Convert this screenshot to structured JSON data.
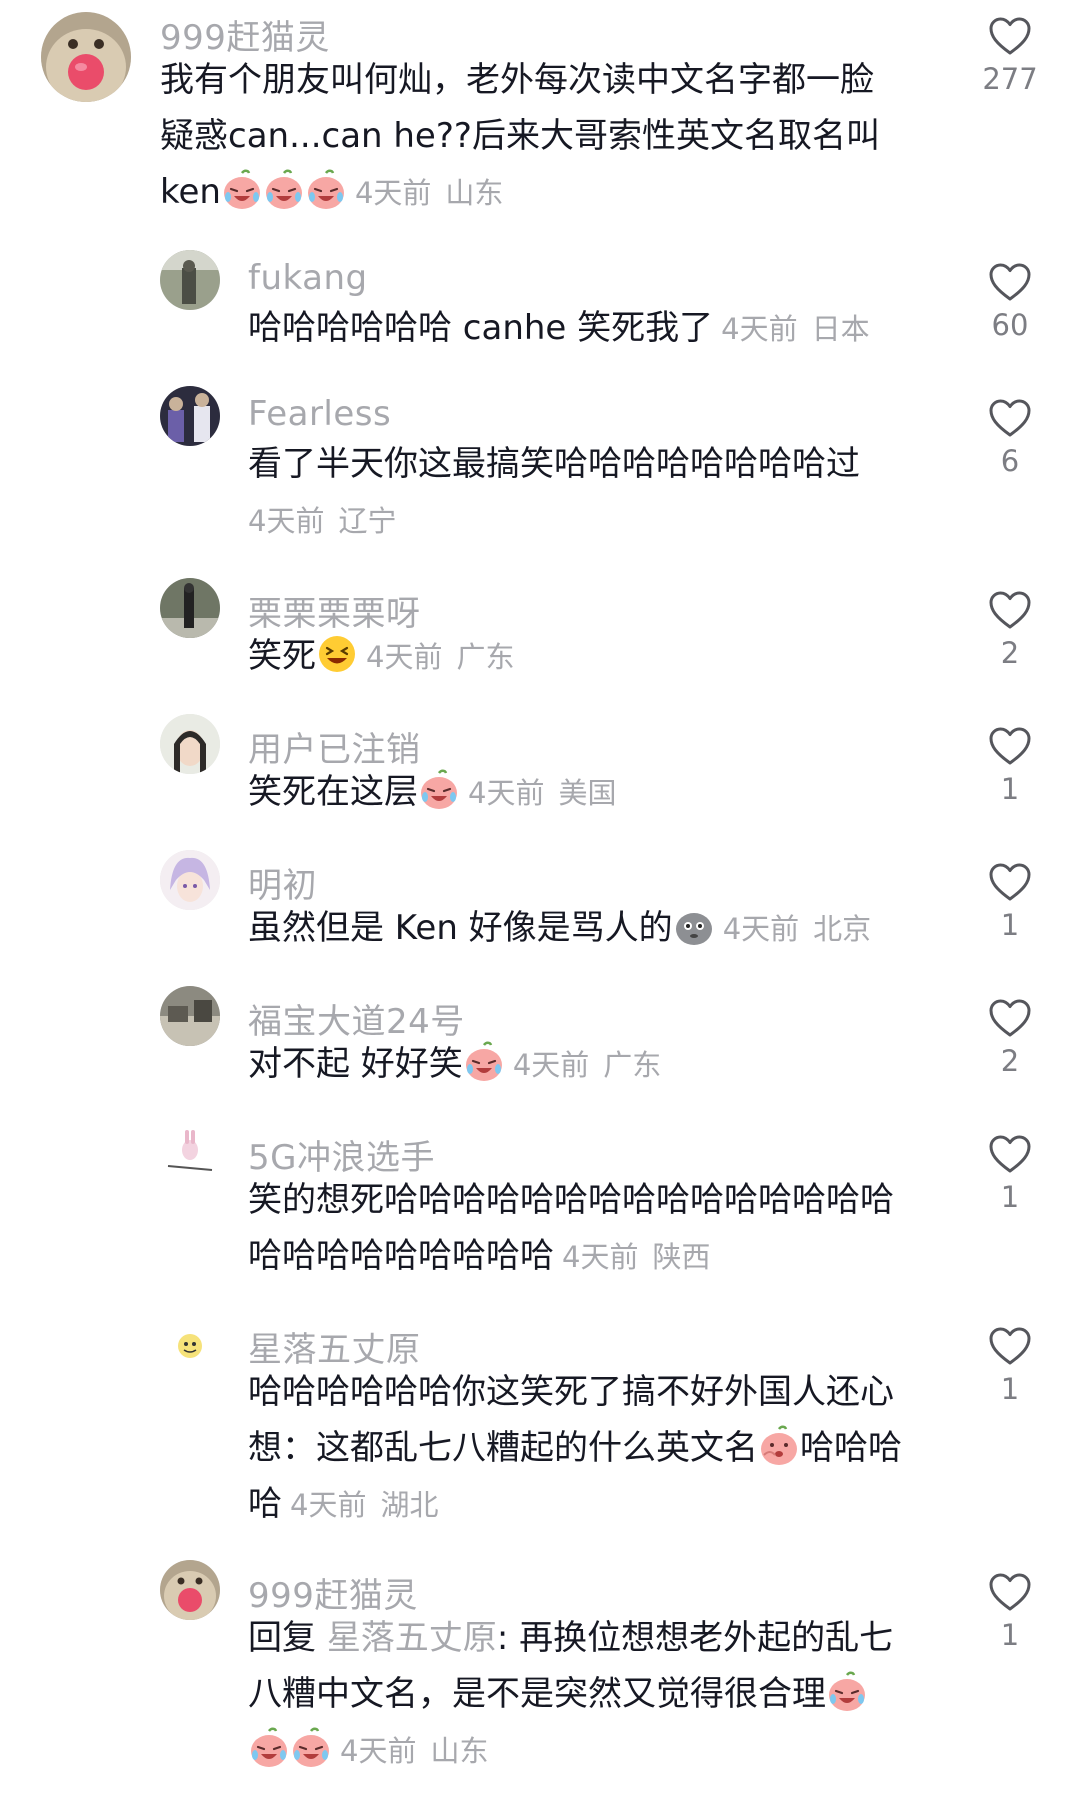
{
  "comments": [
    {
      "username": "999赶猫灵",
      "lines": [
        "我有个朋友叫何灿，老外每次读中文名字都一脸",
        "疑惑can...can he??后来大哥索性英文名取名叫",
        "ken"
      ],
      "time": "4天前",
      "location": "山东",
      "likes": "277"
    },
    {
      "username": "fukang",
      "lines": [
        "哈哈哈哈哈哈 canhe 笑死我了"
      ],
      "time": "4天前",
      "location": "日本",
      "likes": "60"
    },
    {
      "username": "Fearless",
      "lines": [
        "看了半天你这最搞笑哈哈哈哈哈哈哈哈过"
      ],
      "time": "4天前",
      "location": "辽宁",
      "likes": "6"
    },
    {
      "username": "栗栗栗栗呀",
      "lines": [
        "笑死"
      ],
      "time": "4天前",
      "location": "广东",
      "likes": "2"
    },
    {
      "username": "用户已注销",
      "lines": [
        "笑死在这层"
      ],
      "time": "4天前",
      "location": "美国",
      "likes": "1"
    },
    {
      "username": "明初",
      "lines": [
        "虽然但是 Ken 好像是骂人的"
      ],
      "time": "4天前",
      "location": "北京",
      "likes": "1"
    },
    {
      "username": "福宝大道24号",
      "lines": [
        "对不起 好好笑"
      ],
      "time": "4天前",
      "location": "广东",
      "likes": "2"
    },
    {
      "username": "5G冲浪选手",
      "lines": [
        "笑的想死哈哈哈哈哈哈哈哈哈哈哈哈哈哈哈",
        "哈哈哈哈哈哈哈哈哈"
      ],
      "time": "4天前",
      "location": "陕西",
      "likes": "1"
    },
    {
      "username": "星落五丈原",
      "lines": [
        "哈哈哈哈哈哈你这笑死了搞不好外国人还心",
        "想：这都乱七八糟起的什么英文名",
        "哈哈哈",
        "哈"
      ],
      "time": "4天前",
      "location": "湖北",
      "likes": "1"
    },
    {
      "username": "999赶猫灵",
      "reply_prefix": "回复",
      "reply_to": "星落五丈原",
      "lines": [
        ": 再换位想想老外起的乱七",
        "八糟中文名，是不是突然又觉得很合理"
      ],
      "time": "4天前",
      "location": "山东",
      "likes": "1"
    }
  ],
  "icons": {
    "like": "heart-outline-icon",
    "cry_laugh": "peach-cry-laugh-emoji",
    "grin": "grinning-squint-emoji",
    "speechless": "grey-speechless-emoji",
    "shy": "peach-shy-emoji"
  },
  "colors": {
    "meta": "#a7a8ad",
    "text": "#161823",
    "emoji_peach": "#f7a7a4"
  }
}
